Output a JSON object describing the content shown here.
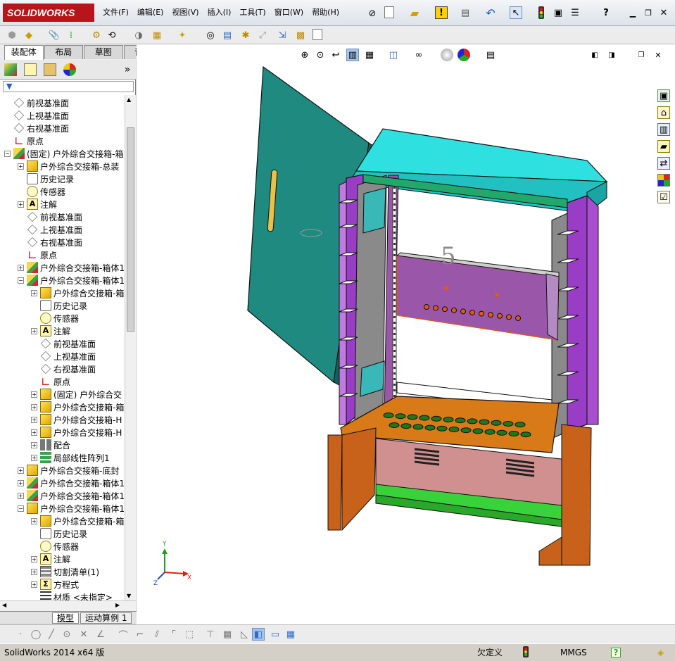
{
  "app": {
    "logo": "SOLIDWORKS",
    "menu": [
      "文件(F)",
      "编辑(E)",
      "视图(V)",
      "插入(I)",
      "工具(T)",
      "窗口(W)",
      "帮助(H)"
    ]
  },
  "command_tabs": [
    "装配体",
    "布局",
    "草图",
    "评估"
  ],
  "tree": {
    "rows": [
      {
        "indent": 0,
        "exp": "",
        "icon": "plane",
        "label": "前视基准面"
      },
      {
        "indent": 0,
        "exp": "",
        "icon": "plane",
        "label": "上视基准面"
      },
      {
        "indent": 0,
        "exp": "",
        "icon": "plane",
        "label": "右视基准面"
      },
      {
        "indent": 0,
        "exp": "",
        "icon": "origin",
        "label": "原点"
      },
      {
        "indent": 0,
        "exp": "−",
        "icon": "asm",
        "label": "(固定) 户外综合交接箱-箱"
      },
      {
        "indent": 1,
        "exp": "+",
        "icon": "part",
        "label": "户外综合交接箱-总装"
      },
      {
        "indent": 1,
        "exp": "",
        "icon": "hist",
        "label": "历史记录"
      },
      {
        "indent": 1,
        "exp": "",
        "icon": "sensor",
        "label": "传感器"
      },
      {
        "indent": 1,
        "exp": "+",
        "icon": "annot",
        "label": "注解"
      },
      {
        "indent": 1,
        "exp": "",
        "icon": "plane",
        "label": "前视基准面"
      },
      {
        "indent": 1,
        "exp": "",
        "icon": "plane",
        "label": "上视基准面"
      },
      {
        "indent": 1,
        "exp": "",
        "icon": "plane",
        "label": "右视基准面"
      },
      {
        "indent": 1,
        "exp": "",
        "icon": "origin",
        "label": "原点"
      },
      {
        "indent": 1,
        "exp": "+",
        "icon": "asm",
        "label": "户外综合交接箱-箱体1"
      },
      {
        "indent": 1,
        "exp": "−",
        "icon": "asm",
        "label": "户外综合交接箱-箱体1"
      },
      {
        "indent": 2,
        "exp": "+",
        "icon": "part",
        "label": "户外综合交接箱-箱"
      },
      {
        "indent": 2,
        "exp": "",
        "icon": "hist",
        "label": "历史记录"
      },
      {
        "indent": 2,
        "exp": "",
        "icon": "sensor",
        "label": "传感器"
      },
      {
        "indent": 2,
        "exp": "+",
        "icon": "annot",
        "label": "注解"
      },
      {
        "indent": 2,
        "exp": "",
        "icon": "plane",
        "label": "前视基准面"
      },
      {
        "indent": 2,
        "exp": "",
        "icon": "plane",
        "label": "上视基准面"
      },
      {
        "indent": 2,
        "exp": "",
        "icon": "plane",
        "label": "右视基准面"
      },
      {
        "indent": 2,
        "exp": "",
        "icon": "origin",
        "label": "原点"
      },
      {
        "indent": 2,
        "exp": "+",
        "icon": "part",
        "label": "(固定) 户外综合交"
      },
      {
        "indent": 2,
        "exp": "+",
        "icon": "part",
        "label": "户外综合交接箱-箱"
      },
      {
        "indent": 2,
        "exp": "+",
        "icon": "part",
        "label": "户外综合交接箱-H"
      },
      {
        "indent": 2,
        "exp": "+",
        "icon": "part",
        "label": "户外综合交接箱-H"
      },
      {
        "indent": 2,
        "exp": "+",
        "icon": "mate",
        "label": "配合"
      },
      {
        "indent": 2,
        "exp": "+",
        "icon": "pattern",
        "label": "局部线性阵列1"
      },
      {
        "indent": 1,
        "exp": "+",
        "icon": "part",
        "label": "户外综合交接箱-底封"
      },
      {
        "indent": 1,
        "exp": "+",
        "icon": "asm",
        "label": "户外综合交接箱-箱体1"
      },
      {
        "indent": 1,
        "exp": "+",
        "icon": "asm",
        "label": "户外综合交接箱-箱体1"
      },
      {
        "indent": 1,
        "exp": "−",
        "icon": "part",
        "label": "户外综合交接箱-箱体1"
      },
      {
        "indent": 2,
        "exp": "+",
        "icon": "part",
        "label": "户外综合交接箱-箱"
      },
      {
        "indent": 2,
        "exp": "",
        "icon": "hist",
        "label": "历史记录"
      },
      {
        "indent": 2,
        "exp": "",
        "icon": "sensor",
        "label": "传感器"
      },
      {
        "indent": 2,
        "exp": "+",
        "icon": "annot",
        "label": "注解"
      },
      {
        "indent": 2,
        "exp": "+",
        "icon": "cut",
        "label": "切割清单(1)"
      },
      {
        "indent": 2,
        "exp": "+",
        "icon": "eq",
        "label": "方程式"
      },
      {
        "indent": 2,
        "exp": "",
        "icon": "mat",
        "label": "材质 <未指定>"
      }
    ]
  },
  "bottom_tabs": [
    "模型",
    "运动算例 1"
  ],
  "viewport": {
    "label": "5",
    "triad": {
      "x": "X",
      "y": "Y",
      "z": "Z"
    }
  },
  "status": {
    "version": "SolidWorks 2014 x64 版",
    "state": "欠定义",
    "units": "MMGS",
    "help": "?"
  },
  "colors": {
    "door": "#1f8a80",
    "roof": "#2fe0e0",
    "side_panel": "#9a3dc6",
    "shelf": "#d97a18",
    "base": "#c8611a",
    "rear_box": "#d09090",
    "green_rail": "#3ad23a",
    "inner_tray": "#9a56a8"
  },
  "icons": {
    "new": "new-document-icon",
    "open": "open-folder-icon",
    "rebuild": "traffic-light-icon",
    "options": "options-icon",
    "help": "help-icon",
    "select": "select-cursor-icon"
  }
}
